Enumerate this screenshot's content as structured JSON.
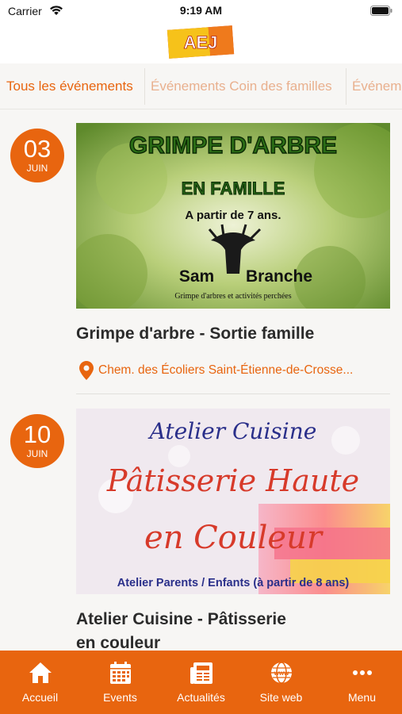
{
  "status_bar": {
    "carrier": "Carrier",
    "time": "9:19 AM"
  },
  "header": {
    "logo_text": "AEJ"
  },
  "tabs": [
    {
      "label": "Tous les événements",
      "active": true
    },
    {
      "label": "Événements Coin des familles",
      "active": false
    },
    {
      "label": "Événem",
      "active": false
    }
  ],
  "events": [
    {
      "day": "03",
      "month": "JUIN",
      "image": {
        "heading": "GRIMPE D'ARBRE",
        "subheading": "EN FAMILLE",
        "age": "A partir de 7 ans.",
        "brand_left": "Sam",
        "brand_right": "Branche",
        "tagline": "Grimpe d'arbres et activités perchées"
      },
      "title": "Grimpe d'arbre - Sortie famille",
      "location": "Chem. des Écoliers Saint-Étienne-de-Crosse..."
    },
    {
      "day": "10",
      "month": "JUIN",
      "image": {
        "line1": "Atelier Cuisine",
        "line2": "Pâtisserie Haute",
        "line3": "en Couleur",
        "footer": "Atelier Parents / Enfants (à partir de 8 ans)"
      },
      "title_line1": "Atelier Cuisine - Pâtisserie",
      "title_line2": "en couleur"
    }
  ],
  "bottom_nav": [
    {
      "label": "Accueil",
      "icon": "home-icon"
    },
    {
      "label": "Events",
      "icon": "calendar-icon"
    },
    {
      "label": "Actualités",
      "icon": "newspaper-icon"
    },
    {
      "label": "Site web",
      "icon": "globe-icon"
    },
    {
      "label": "Menu",
      "icon": "more-dots-icon"
    }
  ],
  "colors": {
    "accent": "#e8650f",
    "tab_inactive": "#e9b08e",
    "background": "#f7f6f4"
  }
}
